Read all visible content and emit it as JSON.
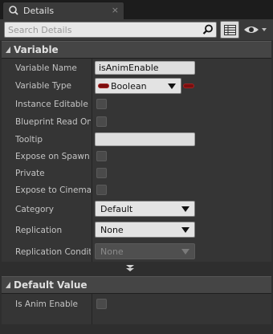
{
  "tab": {
    "title": "Details",
    "close_glyph": "×"
  },
  "toolbar": {
    "search_placeholder": "Search Details"
  },
  "variable_section": {
    "title": "Variable",
    "rows": {
      "variable_name": {
        "label": "Variable Name",
        "value": "isAnimEnable"
      },
      "variable_type": {
        "label": "Variable Type",
        "value": "Boolean"
      },
      "instance_editable": {
        "label": "Instance Editable",
        "checked": false
      },
      "blueprint_read_only": {
        "label": "Blueprint Read Onl",
        "checked": false
      },
      "tooltip": {
        "label": "Tooltip",
        "value": ""
      },
      "expose_on_spawn": {
        "label": "Expose on Spawn",
        "checked": false
      },
      "private": {
        "label": "Private",
        "checked": false
      },
      "expose_to_cinematics": {
        "label": "Expose to Cinemat",
        "checked": false
      },
      "category": {
        "label": "Category",
        "value": "Default"
      },
      "replication": {
        "label": "Replication",
        "value": "None"
      },
      "replication_condition": {
        "label": "Replication Conditi",
        "value": "None"
      }
    }
  },
  "default_value_section": {
    "title": "Default Value",
    "rows": {
      "is_anim_enable": {
        "label": "Is Anim Enable",
        "checked": false
      }
    }
  },
  "colors": {
    "boolean_pin": "#7a0f0f",
    "panel_bg": "#353535",
    "header_bg": "#454545"
  },
  "icons": {
    "tab": "blueprint-icon",
    "search": "magnifier-icon",
    "view_options": "eye-icon",
    "property_matrix": "grid-icon"
  }
}
